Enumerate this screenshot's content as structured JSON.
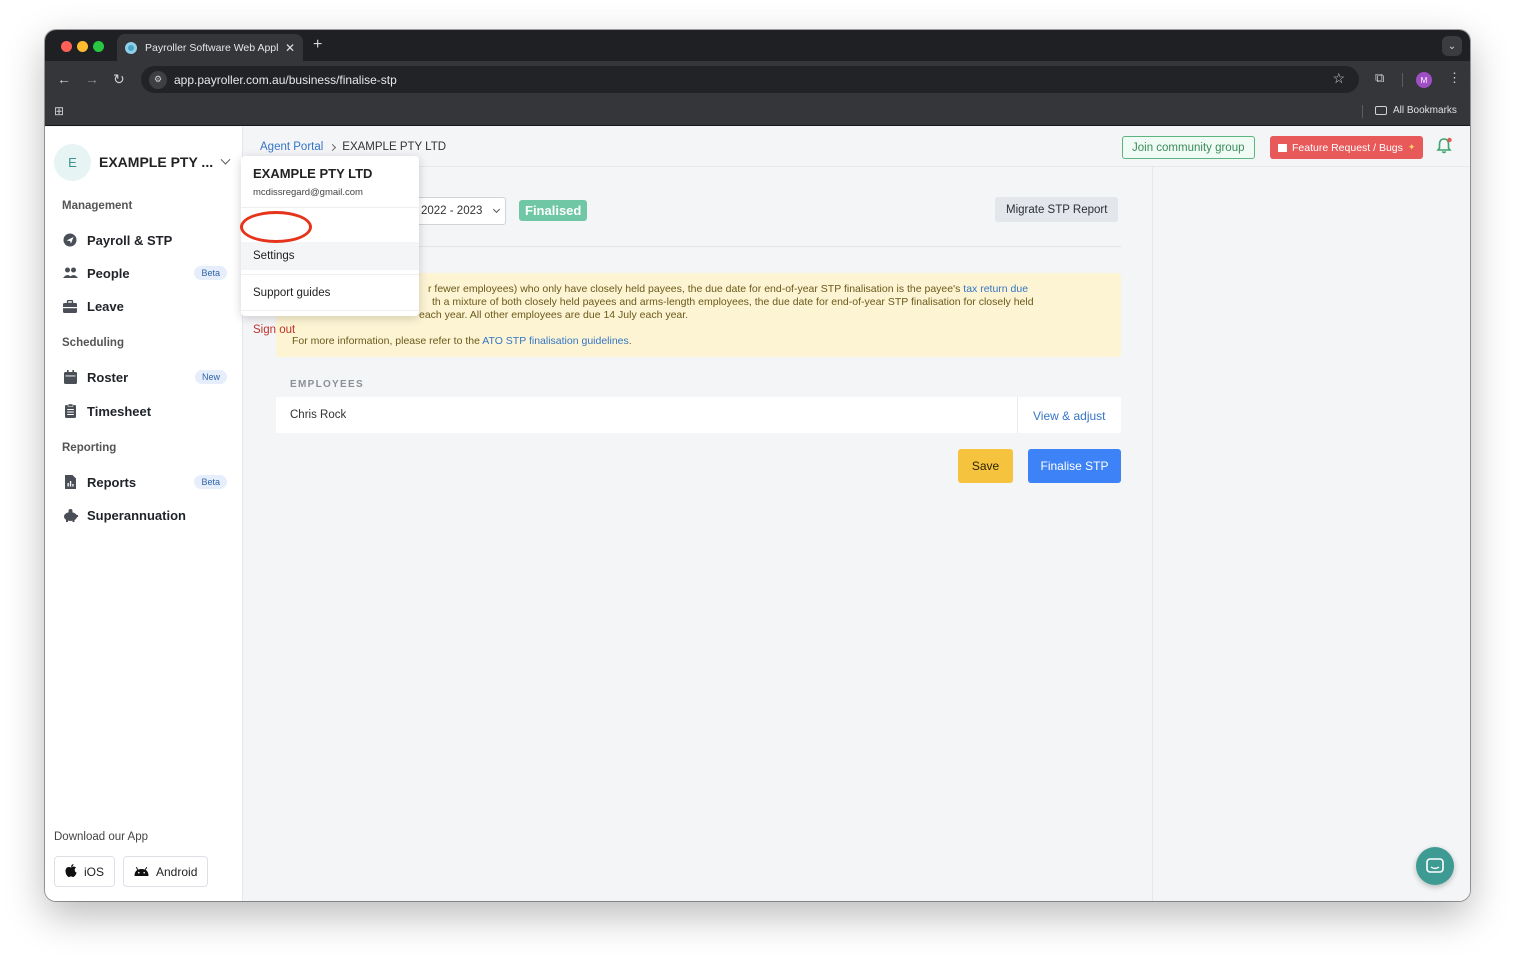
{
  "browser": {
    "tab_title": "Payroller Software Web Appli",
    "url": "app.payroller.com.au/business/finalise-stp",
    "profile_initial": "M",
    "bookmarks_label": "All Bookmarks"
  },
  "sidebar": {
    "company_initial": "E",
    "company_name": "EXAMPLE PTY ...",
    "sections": {
      "management": "Management",
      "scheduling": "Scheduling",
      "reporting": "Reporting"
    },
    "items": {
      "payroll": {
        "label": "Payroll & STP",
        "icon": "paper-plane-icon"
      },
      "people": {
        "label": "People",
        "badge": "Beta",
        "icon": "people-icon"
      },
      "leave": {
        "label": "Leave",
        "icon": "briefcase-icon"
      },
      "roster": {
        "label": "Roster",
        "badge": "New",
        "icon": "calendar-icon"
      },
      "timesheet": {
        "label": "Timesheet",
        "icon": "clipboard-icon"
      },
      "reports": {
        "label": "Reports",
        "badge": "Beta",
        "icon": "report-icon"
      },
      "super": {
        "label": "Superannuation",
        "icon": "piggy-bank-icon"
      }
    },
    "download_label": "Download our App",
    "ios_label": "iOS",
    "android_label": "Android"
  },
  "topbar": {
    "breadcrumb_link": "Agent Portal",
    "breadcrumb_current": "EXAMPLE PTY LTD",
    "community_label": "Join community group",
    "feature_label": "Feature Request / Bugs"
  },
  "stp": {
    "financial_year": "2022 - 2023",
    "status": "Finalised",
    "migrate_label": "Migrate STP Report",
    "notice": {
      "line1_text": "r fewer employees) who only have closely held payees, the due date for end-of-year STP finalisation is the payee's ",
      "line1_link": "tax return due",
      "line2_text": "th a mixture of both closely held payees and arms-length employees, the due date for end-of-year STP finalisation for closely held",
      "line3_text": "each year. All other employees are due 14 July each year.",
      "line4_text": "For more information, please refer to the ",
      "line4_link": "ATO STP finalisation guidelines",
      "line4_end": "."
    },
    "employees_label": "EMPLOYEES",
    "employees": [
      {
        "name": "Chris Rock",
        "action": "View & adjust"
      }
    ],
    "save_label": "Save",
    "finalise_label": "Finalise STP"
  },
  "menu": {
    "company": "EXAMPLE PTY LTD",
    "email": "mcdissregard@gmail.com",
    "settings": "Settings",
    "support": "Support guides",
    "signout": "Sign out"
  },
  "colors": {
    "accent_blue": "#3d82f6",
    "link_blue": "#3575c7",
    "finalised_green": "#6fc7a5",
    "save_yellow": "#f6c33f",
    "notice_bg": "#fcf4d2",
    "annotation_red": "#e5341b",
    "signout_red": "#c0312b"
  }
}
